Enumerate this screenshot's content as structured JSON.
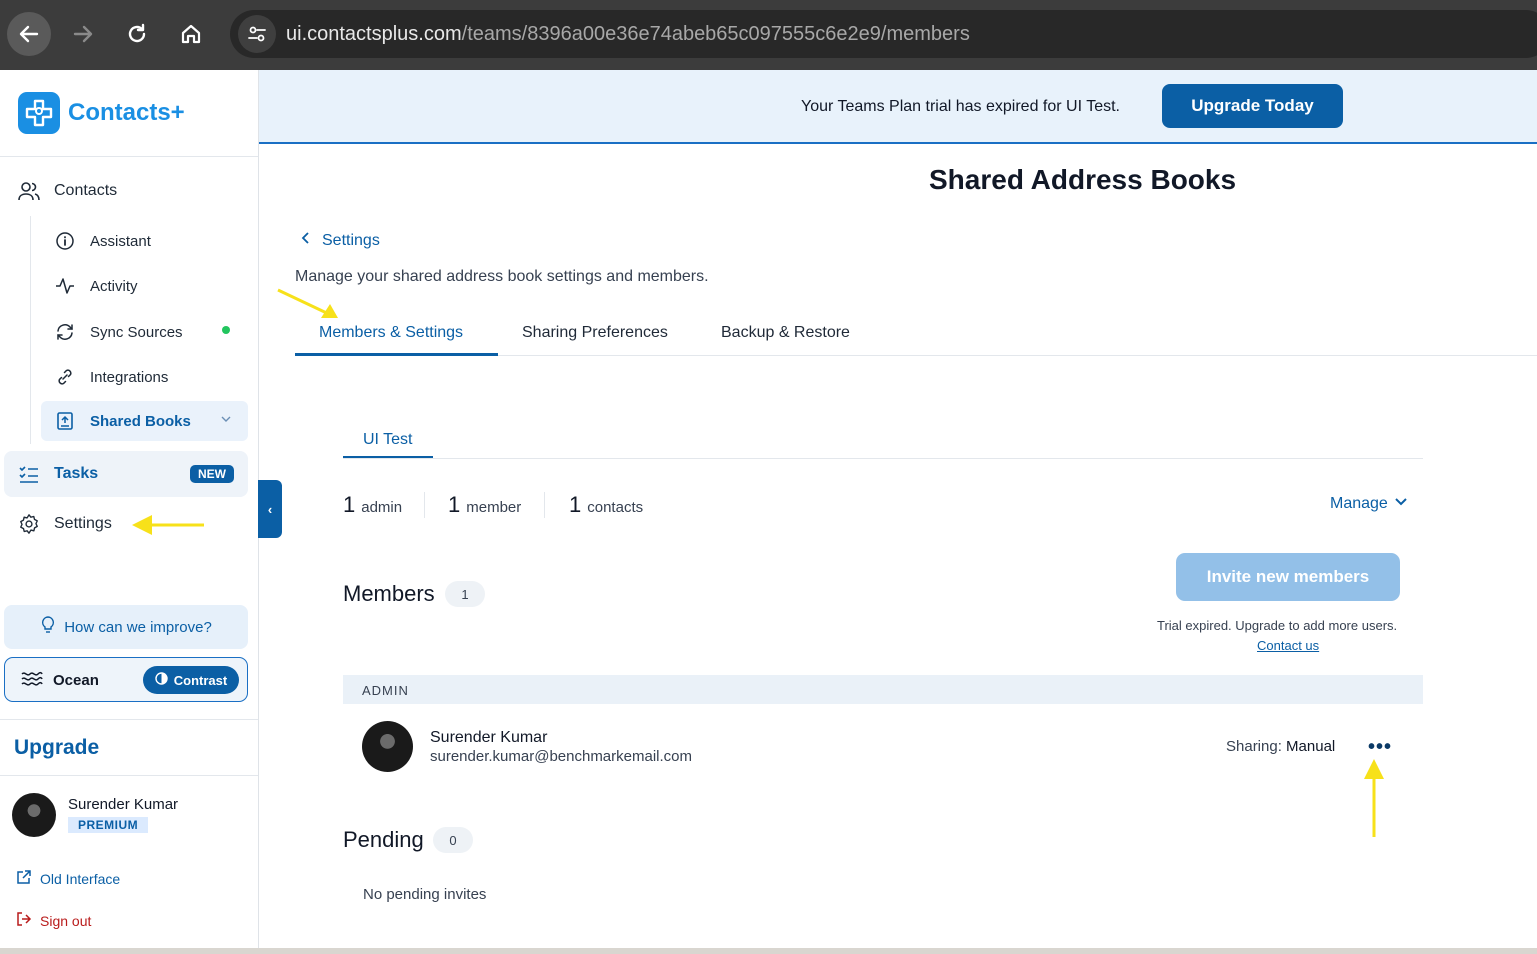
{
  "browser": {
    "url_host": "ui.contactsplus.com",
    "url_path": "/teams/8396a00e36e74abeb65c097555c6e2e9/members"
  },
  "sidebar": {
    "logo_text": "Contacts+",
    "contacts_label": "Contacts",
    "items": [
      {
        "label": "Assistant",
        "icon": "info-circle-icon"
      },
      {
        "label": "Activity",
        "icon": "activity-pulse-icon"
      },
      {
        "label": "Sync Sources",
        "icon": "sync-icon"
      },
      {
        "label": "Integrations",
        "icon": "link-icon"
      },
      {
        "label": "Shared Books",
        "icon": "book-icon"
      }
    ],
    "tasks_label": "Tasks",
    "tasks_badge": "NEW",
    "settings_label": "Settings",
    "improve_label": "How can we improve?",
    "theme_label": "Ocean",
    "contrast_label": "Contrast",
    "upgrade_label": "Upgrade",
    "user_name": "Surender Kumar",
    "user_plan": "PREMIUM",
    "old_interface_label": "Old Interface",
    "sign_out_label": "Sign out"
  },
  "banner": {
    "text": "Your Teams Plan trial has expired for UI Test.",
    "button": "Upgrade Today"
  },
  "main": {
    "title": "Shared Address Books",
    "back_label": "Settings",
    "description": "Manage your shared address book settings and members.",
    "tabs": [
      "Members & Settings",
      "Sharing Preferences",
      "Backup & Restore"
    ],
    "active_tab": "Members & Settings",
    "book_tab": "UI Test",
    "stats": [
      {
        "num": "1",
        "label": "admin"
      },
      {
        "num": "1",
        "label": "member"
      },
      {
        "num": "1",
        "label": "contacts"
      }
    ],
    "manage_label": "Manage",
    "members_title": "Members",
    "members_count": "1",
    "invite_button": "Invite new members",
    "trial_note": "Trial expired. Upgrade to add more users.",
    "contact_us": "Contact us",
    "admin_header": "ADMIN",
    "member": {
      "name": "Surender Kumar",
      "email": "surender.kumar@benchmarkemail.com",
      "sharing_label": "Sharing:",
      "sharing_value": "Manual",
      "more": "•••"
    },
    "pending_title": "Pending",
    "pending_count": "0",
    "no_pending": "No pending invites"
  },
  "colors": {
    "accent": "#0b5fa5",
    "annotation_arrow": "#f7e11a"
  }
}
